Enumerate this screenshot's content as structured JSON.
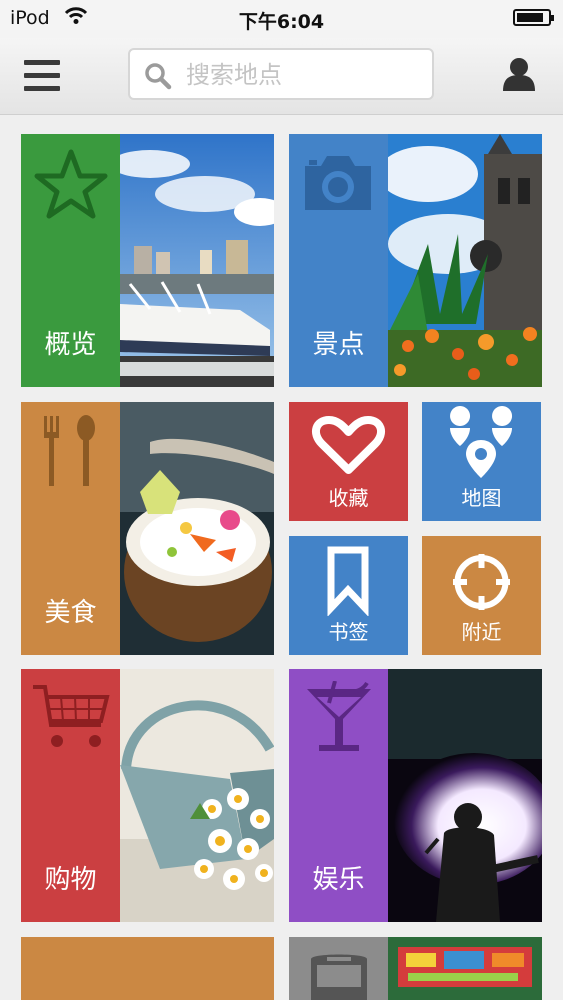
{
  "status_bar": {
    "carrier": "iPod",
    "time": "下午6:04"
  },
  "search": {
    "placeholder": "搜索地点"
  },
  "colors": {
    "green": "#3a9a3e",
    "blue": "#4383c8",
    "orange": "#cb8843",
    "red": "#cb3f41",
    "purple": "#8f4ec5",
    "gray": "#8c8c8c"
  },
  "tiles": [
    {
      "label": "概览",
      "icon": "star-icon"
    },
    {
      "label": "景点",
      "icon": "camera-icon"
    },
    {
      "label": "美食",
      "icon": "fork-spoon-icon"
    },
    {
      "label": "购物",
      "icon": "shopping-cart-icon"
    },
    {
      "label": "娱乐",
      "icon": "cocktail-icon"
    },
    {
      "label": "",
      "icon": "bus-icon"
    }
  ],
  "small_tiles": [
    {
      "label": "收藏",
      "icon": "heart-icon"
    },
    {
      "label": "地图",
      "icon": "map-pins-icon"
    },
    {
      "label": "书签",
      "icon": "bookmark-icon"
    },
    {
      "label": "附近",
      "icon": "crosshair-icon"
    }
  ]
}
